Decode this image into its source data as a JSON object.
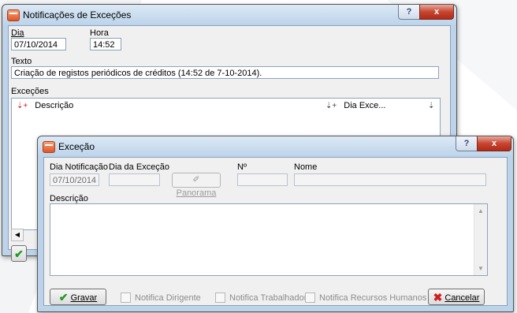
{
  "parent": {
    "title": "Notificações de Exceções",
    "dia_label": "Dia",
    "dia_value": "07/10/2014",
    "hora_label": "Hora",
    "hora_value": "14:52",
    "texto_label": "Texto",
    "texto_value": "Criação de registos periódicos de créditos (14:52 de 7-10-2014).",
    "excecoes_label": "Exceções",
    "columns": [
      "Descrição",
      "Dia Exce..."
    ]
  },
  "dialog": {
    "title": "Exceção",
    "dia_notificacao_label": "Dia Notificação",
    "dia_notificacao_value": "07/10/2014",
    "dia_excecao_label": "Dia da Exceção",
    "panorama_label": "Panorama",
    "numero_label": "Nº",
    "nome_label": "Nome",
    "descricao_label": "Descrição",
    "gravar_label": "Gravar",
    "notifica_dirigente": "Notifica Dirigente",
    "notifica_trabalhador": "Notifica Trabalhador",
    "notifica_rh": "Notifica Recursos Humanos",
    "cancelar_label": "Cancelar"
  },
  "icons": {
    "help": "?",
    "close": "x"
  }
}
